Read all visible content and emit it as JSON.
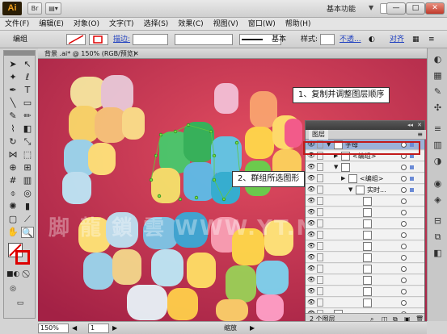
{
  "app": {
    "logo": "Ai",
    "workspace_label": "基本功能",
    "window_controls": [
      "—",
      "□",
      "✕"
    ]
  },
  "menu": [
    "文件(F)",
    "编辑(E)",
    "对象(O)",
    "文字(T)",
    "选择(S)",
    "效果(C)",
    "视图(V)",
    "窗口(W)",
    "帮助(H)"
  ],
  "control_bar": {
    "selection_type": "编组",
    "stroke_label": "描边:",
    "stroke_style": "基本",
    "style_label": "样式:",
    "opacity_link": "不透...",
    "align_label": "对齐"
  },
  "document": {
    "tab_title": "背景 .ai* @ 150% (RGB/预览)"
  },
  "callouts": {
    "step1": "1、复制并调整图层顺序",
    "step2": "2、群组所选图形"
  },
  "layers_panel": {
    "tab": "图层",
    "rows": [
      {
        "name": "字母",
        "indent": 0,
        "expanded": true
      },
      {
        "name": "<编组>",
        "indent": 1,
        "expanded": false
      },
      {
        "name": "",
        "indent": 1,
        "expanded": true
      },
      {
        "name": "<编组>",
        "indent": 2,
        "expanded": false
      },
      {
        "name": "实时...",
        "indent": 3,
        "expanded": true
      },
      {
        "name": "",
        "indent": 4
      },
      {
        "name": "",
        "indent": 4
      },
      {
        "name": "",
        "indent": 4
      },
      {
        "name": "",
        "indent": 4
      },
      {
        "name": "",
        "indent": 4
      },
      {
        "name": "",
        "indent": 4
      },
      {
        "name": "",
        "indent": 4
      },
      {
        "name": "",
        "indent": 4
      },
      {
        "name": "",
        "indent": 4
      },
      {
        "name": "",
        "indent": 4
      },
      {
        "name": "",
        "indent": 0
      }
    ],
    "footer": "2 个图层"
  },
  "status_bar": {
    "zoom": "150%",
    "page": "1",
    "tool_name": "缩放"
  },
  "watermark": "脚 龍 鎖 雲 WWW.YT.NET",
  "colors": {
    "canvas_bg": "#c1324e",
    "highlight_border": "#c21a1a",
    "selected_layer": "#9bb2d8"
  }
}
